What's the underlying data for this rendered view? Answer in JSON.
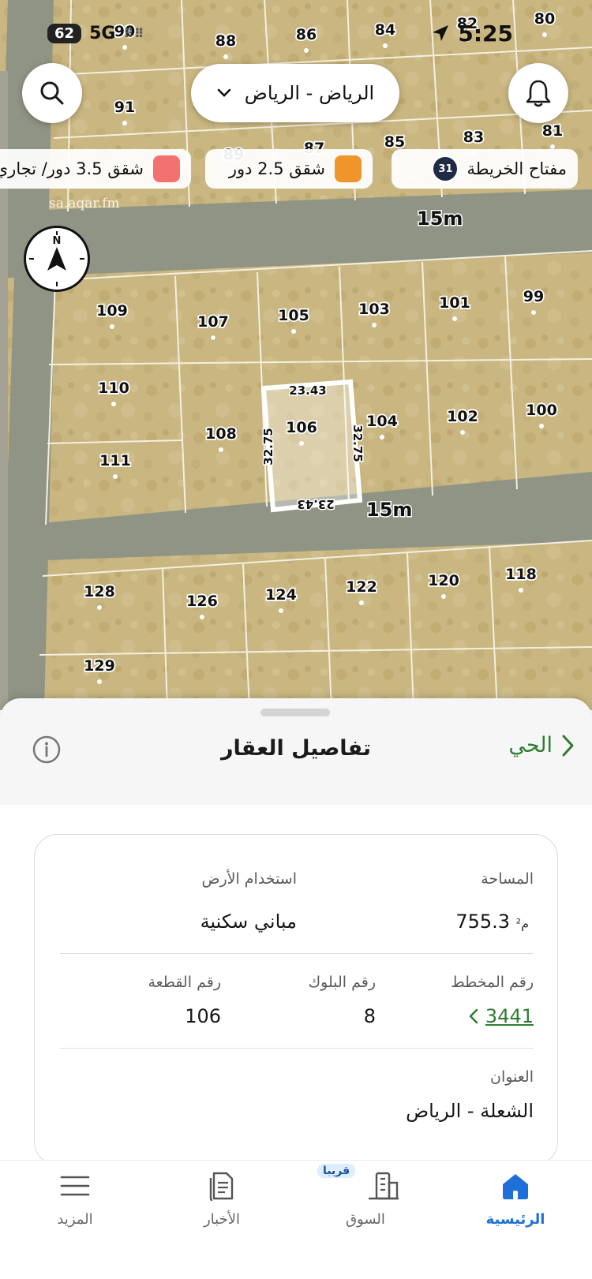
{
  "status_bar": {
    "battery": "62",
    "network": "5G",
    "signal": "⠿⠿",
    "time": "5:25"
  },
  "map": {
    "location": "الرياض - الرياض",
    "legend": {
      "key_label": "مفتاح الخريطة",
      "key_count": "31",
      "chip_25": "شقق 2.5 دور",
      "chip_35": "شقق 3.5 دور/ تجاري"
    },
    "watermark": "sa.aqar.fm",
    "compass_label": "N",
    "road_labels": [
      "15m",
      "15m"
    ],
    "selected_lot": {
      "number": "106",
      "top": "23.43",
      "bottom": "23.43",
      "left": "32.75",
      "right": "32.75"
    },
    "lot_numbers": [
      "80",
      "82",
      "84",
      "86",
      "88",
      "90",
      "91",
      "81",
      "83",
      "85",
      "87",
      "89",
      "99",
      "101",
      "103",
      "105",
      "107",
      "109",
      "110",
      "100",
      "102",
      "104",
      "106",
      "108",
      "111",
      "118",
      "120",
      "122",
      "124",
      "126",
      "128",
      "129"
    ],
    "colors": {
      "land": "#c9b680",
      "road": "#8f9485",
      "chip_25": "#f0952a",
      "chip_35": "#f47171"
    }
  },
  "sheet": {
    "title": "تفاصيل العقار",
    "neighborhood": "الحي",
    "info_icon": "info-icon",
    "area_label": "المساحة",
    "area_value": "755.3",
    "area_unit": "م²",
    "land_use_label": "استخدام الأرض",
    "land_use_value": "مباني سكنية",
    "plan_label": "رقم المخطط",
    "plan_value": "3441",
    "block_label": "رقم البلوك",
    "block_value": "8",
    "lot_label": "رقم القطعة",
    "lot_value": "106",
    "address_label": "العنوان",
    "address_value": "الشعلة - الرياض",
    "accent_color": "#2e7d32"
  },
  "tabbar": {
    "home": "الرئيسية",
    "market": "السوق",
    "market_badge": "قريبا",
    "news": "الأخبار",
    "more": "المزيد",
    "active_color": "#1e6fd9"
  }
}
